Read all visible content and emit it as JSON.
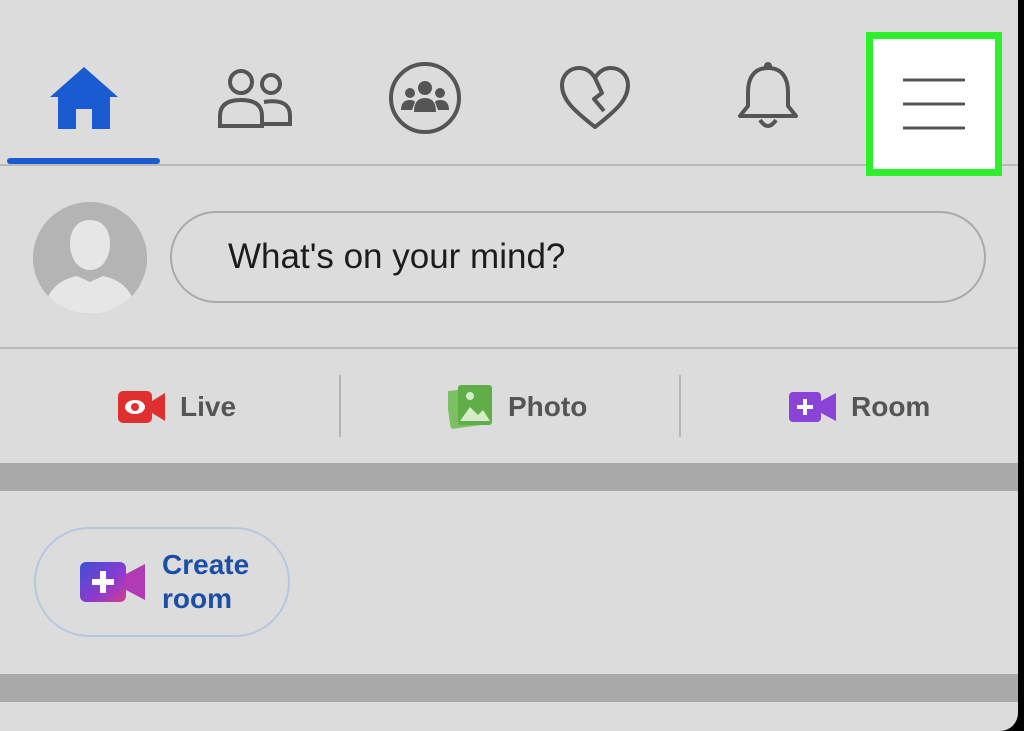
{
  "nav": {
    "tabs": [
      {
        "name": "Home",
        "icon": "home-icon",
        "active": true
      },
      {
        "name": "Friends",
        "icon": "friends-icon",
        "active": false
      },
      {
        "name": "Groups",
        "icon": "groups-icon",
        "active": false
      },
      {
        "name": "Dating",
        "icon": "heart-icon",
        "active": false
      },
      {
        "name": "Notifications",
        "icon": "bell-icon",
        "active": false
      },
      {
        "name": "Menu",
        "icon": "hamburger-menu-icon",
        "active": false,
        "highlighted": true
      }
    ],
    "active_color": "#1a5bd1",
    "highlight_color": "#2df02a"
  },
  "composer": {
    "placeholder": "What's on your mind?"
  },
  "actions": {
    "live_label": "Live",
    "photo_label": "Photo",
    "room_label": "Room",
    "live_color": "#e02f2f",
    "photo_color": "#5fae47",
    "room_color": "#8a43d6"
  },
  "create_room": {
    "label": "Create\nroom",
    "color": "#1b4fa6"
  }
}
